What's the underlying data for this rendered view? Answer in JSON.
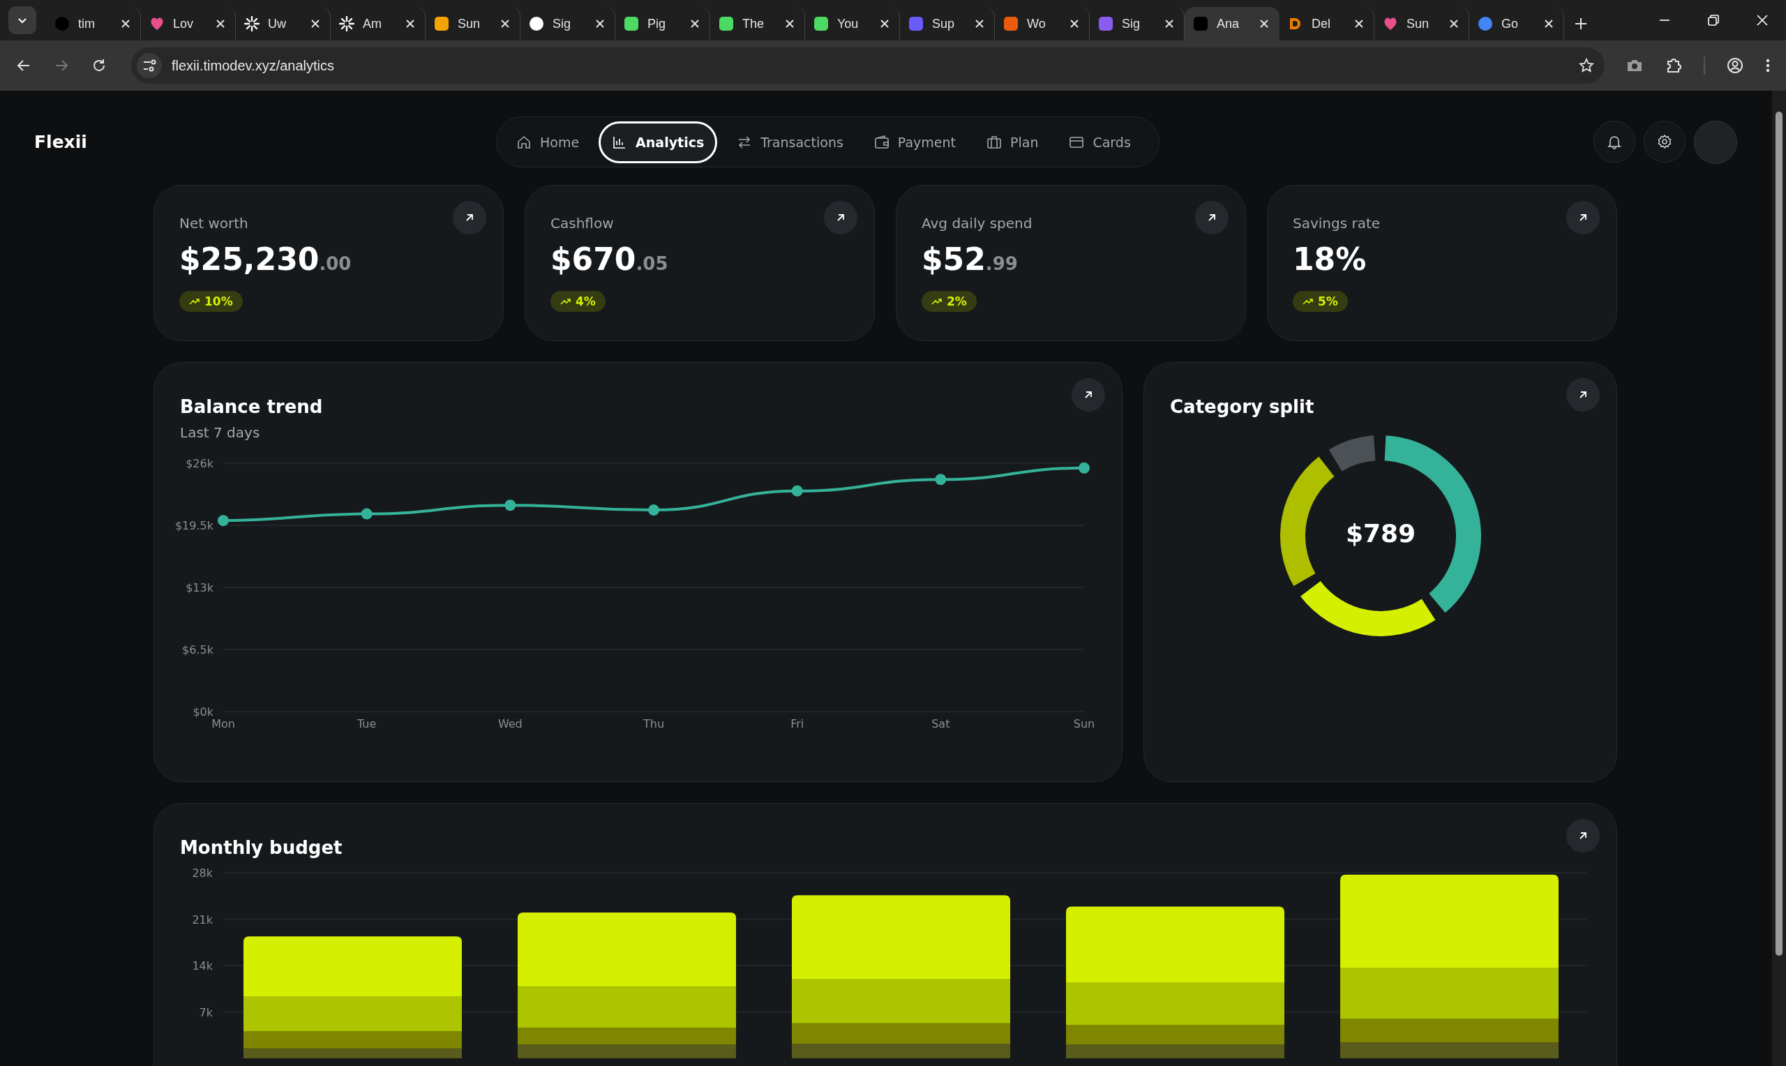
{
  "browser": {
    "tabs": [
      {
        "title": "tim",
        "kind": "circle",
        "color": "#000000",
        "selected": false
      },
      {
        "title": "Lov",
        "kind": "heart",
        "color": "#e8508c",
        "selected": false
      },
      {
        "title": "Uw",
        "kind": "asterisk",
        "color": "#ffffff",
        "selected": false
      },
      {
        "title": "Am",
        "kind": "asterisk",
        "color": "#ffffff",
        "selected": false
      },
      {
        "title": "Sun",
        "kind": "square",
        "color": "#f5a300",
        "selected": false
      },
      {
        "title": "Sig",
        "kind": "circle",
        "color": "#ffffff",
        "selected": false
      },
      {
        "title": "Pig",
        "kind": "square",
        "color": "#4cd964",
        "selected": false
      },
      {
        "title": "The",
        "kind": "square",
        "color": "#4cd964",
        "selected": false
      },
      {
        "title": "You",
        "kind": "square",
        "color": "#4cd964",
        "selected": false
      },
      {
        "title": "Sup",
        "kind": "square",
        "color": "#6a5af9",
        "selected": false
      },
      {
        "title": "Wo",
        "kind": "square",
        "color": "#ea5b0c",
        "selected": false
      },
      {
        "title": "Sig",
        "kind": "square",
        "color": "#8a5cf0",
        "selected": false
      },
      {
        "title": "Ana",
        "kind": "square",
        "color": "#000000",
        "selected": true
      },
      {
        "title": "Del",
        "kind": "letter",
        "color": "#f07d00",
        "selected": false
      },
      {
        "title": "Sun",
        "kind": "heart",
        "color": "#e8508c",
        "selected": false
      },
      {
        "title": "Go",
        "kind": "circle",
        "color": "#4285f4",
        "selected": false
      }
    ],
    "address": "flexii.timodev.xyz/analytics"
  },
  "app": {
    "logo": "Flexii",
    "nav": [
      {
        "label": "Home",
        "kind": "home",
        "selected": false
      },
      {
        "label": "Analytics",
        "kind": "chart",
        "selected": true
      },
      {
        "label": "Transactions",
        "kind": "arrows",
        "selected": false
      },
      {
        "label": "Payment",
        "kind": "wallet",
        "selected": false
      },
      {
        "label": "Plan",
        "kind": "briefcase",
        "selected": false
      },
      {
        "label": "Cards",
        "kind": "card",
        "selected": false
      }
    ]
  },
  "stats": [
    {
      "label": "Net worth",
      "value": "$25,230",
      "cents": ".00",
      "change": "10%"
    },
    {
      "label": "Cashflow",
      "value": "$670",
      "cents": ".05",
      "change": "4%"
    },
    {
      "label": "Avg daily spend",
      "value": "$52",
      "cents": ".99",
      "change": "2%"
    },
    {
      "label": "Savings rate",
      "value": "18%",
      "change": "5%"
    }
  ],
  "balance_trend": {
    "title": "Balance trend",
    "subtitle": "Last 7 days",
    "chart_data": {
      "type": "line",
      "categories": [
        "Mon",
        "Tue",
        "Wed",
        "Thu",
        "Fri",
        "Sat",
        "Sun"
      ],
      "series": [
        {
          "color": "#35b39a",
          "marker": true,
          "values": [
            20000,
            20700,
            21600,
            21100,
            23100,
            24300,
            25500
          ]
        }
      ],
      "grid": true,
      "ylim": [
        0,
        26000
      ],
      "yticks": [
        {
          "value": 0,
          "label": "$0k"
        },
        {
          "value": 6500,
          "label": "$6.5k"
        },
        {
          "value": 13000,
          "label": "$13k"
        },
        {
          "value": 19500,
          "label": "$19.5k"
        },
        {
          "value": 26000,
          "label": "$26k"
        }
      ]
    }
  },
  "category_split": {
    "title": "Category split",
    "total": "$789"
  },
  "monthly_budget": {
    "title": "Monthly budget",
    "chart_data": {
      "type": "bar",
      "stacked": true,
      "series": [
        {
          "color": "#5a5c1c",
          "values": [
            1500,
            2100,
            2200,
            2100,
            2400
          ]
        },
        {
          "color": "#7f8700",
          "values": [
            2600,
            2500,
            3100,
            2900,
            3600
          ]
        },
        {
          "color": "#adc400",
          "values": [
            5200,
            6200,
            6700,
            6400,
            7600
          ]
        },
        {
          "color": "#d4f000",
          "values": [
            9100,
            11200,
            12600,
            11500,
            14100
          ]
        }
      ],
      "grid": true,
      "ylim": [
        0,
        28000
      ],
      "yticks": [
        {
          "value": 7000,
          "label": "7k"
        },
        {
          "value": 14000,
          "label": "14k"
        },
        {
          "value": 21000,
          "label": "21k"
        },
        {
          "value": 28000,
          "label": "28k"
        }
      ]
    }
  }
}
